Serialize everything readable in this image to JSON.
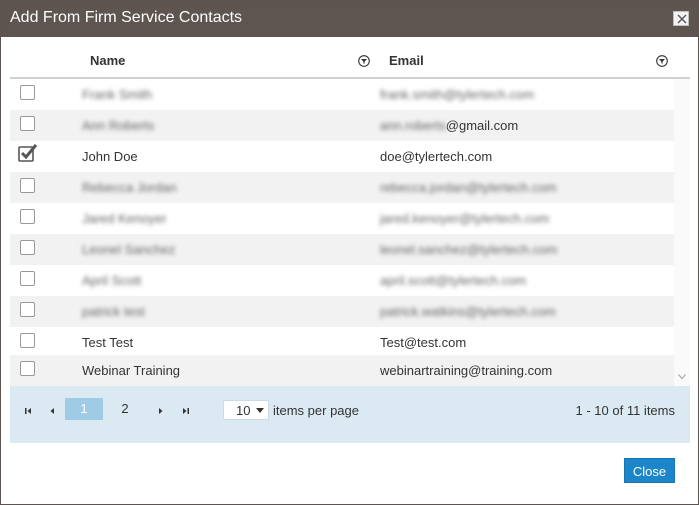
{
  "dialog": {
    "title": "Add From Firm Service Contacts",
    "close_icon": "close-icon"
  },
  "grid": {
    "columns": [
      {
        "label": "Name",
        "filter_icon": "filter-icon"
      },
      {
        "label": "Email",
        "filter_icon": "filter-icon"
      }
    ],
    "rows": [
      {
        "checked": false,
        "name": "Frank Smith",
        "email": "frank.smith@tylertech.com",
        "redacted": true
      },
      {
        "checked": false,
        "name": "Ann Roberts",
        "email": "ann.roberts@gmail.com",
        "redacted": true,
        "email_visible_part": "@gmail.com"
      },
      {
        "checked": true,
        "name": "John Doe",
        "email": "doe@tylertech.com",
        "redacted": false
      },
      {
        "checked": false,
        "name": "Rebecca Jordan",
        "email": "rebecca.jordan@tylertech.com",
        "redacted": true
      },
      {
        "checked": false,
        "name": "Jared Kenoyer",
        "email": "jared.kenoyer@tylertech.com",
        "redacted": true
      },
      {
        "checked": false,
        "name": "Leonel Sanchez",
        "email": "leonel.sanchez@tylertech.com",
        "redacted": true
      },
      {
        "checked": false,
        "name": "April Scott",
        "email": "april.scott@tylertech.com",
        "redacted": true
      },
      {
        "checked": false,
        "name": "patrick test",
        "email": "patrick.watkins@tylertech.com",
        "redacted": true
      },
      {
        "checked": false,
        "name": "Test Test",
        "email": "Test@test.com",
        "redacted": false
      },
      {
        "checked": false,
        "name": "Webinar Training",
        "email": "webinartraining@training.com",
        "redacted": false
      }
    ]
  },
  "pager": {
    "pages": [
      "1",
      "2"
    ],
    "current_page": "1",
    "per_page_value": "10",
    "per_page_label": "items per page",
    "info": "1 - 10 of 11 items",
    "icons": [
      "first-page-icon",
      "prev-page-icon",
      "next-page-icon",
      "last-page-icon"
    ]
  },
  "footer": {
    "close_label": "Close"
  },
  "colors": {
    "titlebar": "#5e5450",
    "panel": "#dbe9f3",
    "active_page": "#9fcbe6",
    "close_button": "#1b86c9"
  }
}
